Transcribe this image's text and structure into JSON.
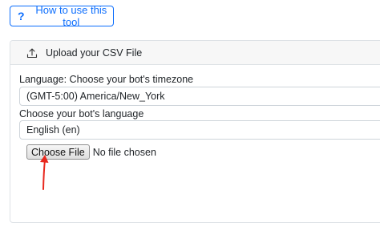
{
  "help_button": {
    "icon": "question-icon",
    "icon_glyph": "?",
    "label": "How to use this tool",
    "color": "#0d6efd"
  },
  "panel": {
    "header": {
      "icon": "upload-icon",
      "label": "Upload your CSV File"
    },
    "timezone": {
      "label": "Language:  Choose your bot's timezone",
      "value": "(GMT-5:00) America/New_York"
    },
    "language": {
      "label": "Choose your bot's language",
      "value": "English (en)"
    },
    "file_input": {
      "button_label": "Choose File",
      "status": "No file chosen"
    }
  },
  "annotation": {
    "icon": "red-arrow-icon",
    "color": "#e8281e"
  }
}
